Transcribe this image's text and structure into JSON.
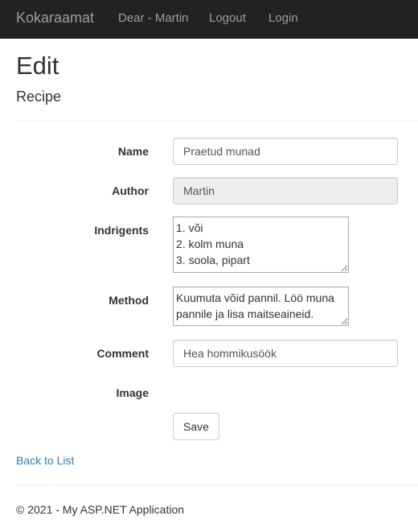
{
  "navbar": {
    "brand": "Kokaraamat",
    "links": [
      "Dear - Martin",
      "Logout",
      "Login"
    ]
  },
  "page": {
    "title": "Edit",
    "subtitle": "Recipe"
  },
  "form": {
    "name_label": "Name",
    "name_value": "Praetud munad",
    "author_label": "Author",
    "author_value": "Martin",
    "ingredients_label": "Indrigents",
    "ingredients_value": "1. või\n2. kolm muna\n3. soola, pipart",
    "method_label": "Method",
    "method_value": "Kuumuta võid pannil. Löö muna pannile ja lisa maitseaineid.",
    "comment_label": "Comment",
    "comment_value": "Hea hommikusöök",
    "image_label": "Image",
    "save_label": "Save"
  },
  "back_link": "Back to List",
  "footer": "© 2021 - My ASP.NET Application"
}
